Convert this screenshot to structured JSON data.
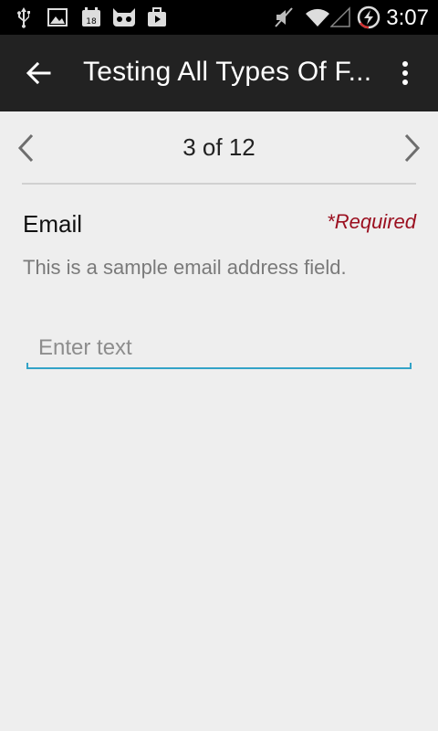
{
  "status_bar": {
    "time": "3:07",
    "icons": [
      "usb-icon",
      "gallery-icon",
      "calendar-icon",
      "cyanogenmod-icon",
      "media-icon",
      "mute-icon",
      "wifi-icon",
      "signal-icon",
      "battery-charging-icon"
    ],
    "calendar_day": "18"
  },
  "app_bar": {
    "title": "Testing All Types Of F..."
  },
  "pager": {
    "count": "3 of 12"
  },
  "field": {
    "label": "Email",
    "required": "*Required",
    "description": "This is a sample email address field.",
    "placeholder": "Enter text",
    "value": ""
  },
  "colors": {
    "accent": "#33a3c7",
    "required": "#9b1020",
    "app_bar": "#222222",
    "background": "#eeeeee"
  }
}
